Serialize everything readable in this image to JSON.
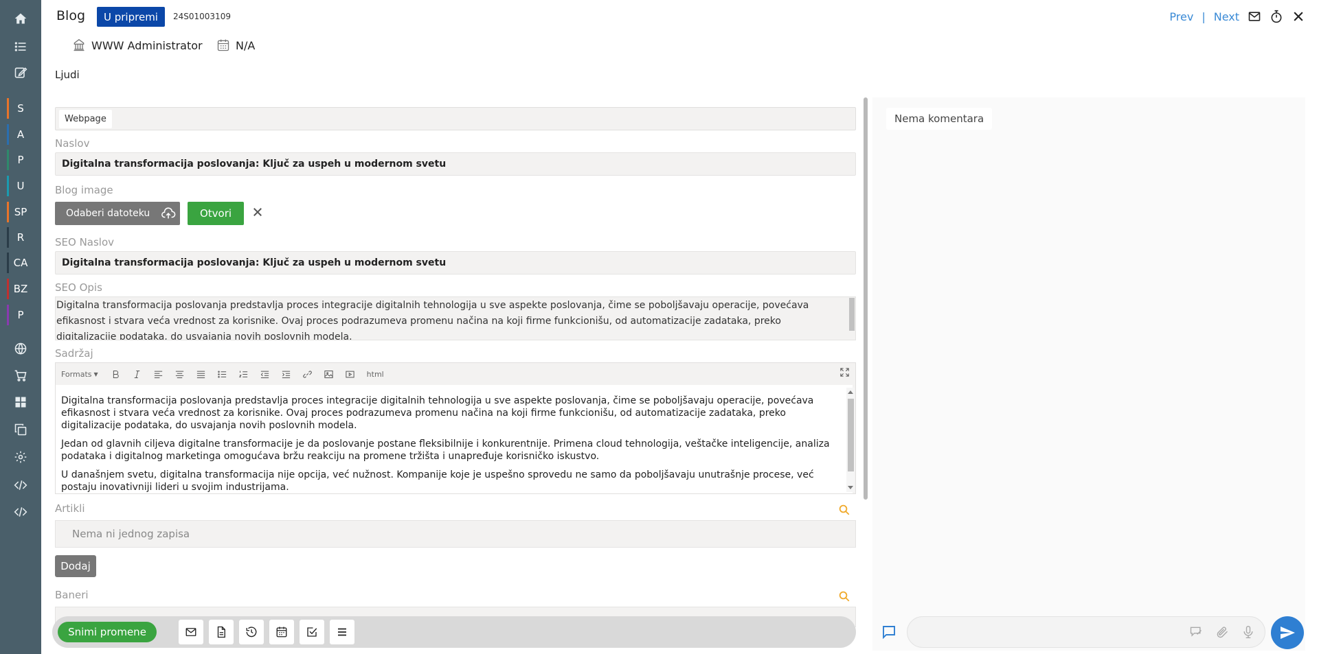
{
  "header": {
    "title": "Blog",
    "status": "U pripremi",
    "doc_number": "24S01003109",
    "owner": "WWW Administrator",
    "date": "N/A",
    "prev": "Prev",
    "next": "Next",
    "separator": "|"
  },
  "sidebar": {
    "icons": [
      "home-icon",
      "list-icon",
      "edit-icon"
    ],
    "letters": [
      {
        "label": "S",
        "color": "#e8742a"
      },
      {
        "label": "A",
        "color": "#2a6fb0"
      },
      {
        "label": "P",
        "color": "#2f8a6c"
      },
      {
        "label": "U",
        "color": "#1a9bb0"
      },
      {
        "label": "SP",
        "color": "#e8742a"
      },
      {
        "label": "R",
        "color": "#2a3c48"
      },
      {
        "label": "CA",
        "color": "#2a3c48"
      },
      {
        "label": "BZ",
        "color": "#c03030"
      },
      {
        "label": "P",
        "color": "#8a3ab0"
      }
    ],
    "bottom_icons": [
      "globe-icon",
      "cart-icon",
      "dashboard-icon",
      "copy-icon",
      "settings-icon",
      "code-icon",
      "code-icon"
    ]
  },
  "section": "Ljudi",
  "form": {
    "tab": "Webpage",
    "title_label": "Naslov",
    "title_value": "Digitalna transformacija poslovanja: Ključ za uspeh u modernom svetu",
    "image_label": "Blog image",
    "choose_file": "Odaberi datoteku",
    "open": "Otvori",
    "seo_title_label": "SEO Naslov",
    "seo_title_value": "Digitalna transformacija poslovanja: Ključ za uspeh u modernom svetu",
    "seo_desc_label": "SEO Opis",
    "seo_desc_value": "Digitalna transformacija poslovanja predstavlja proces integracije digitalnih tehnologija u sve aspekte poslovanja, čime se poboljšavaju operacije, povećava efikasnost i stvara veća vrednost za korisnike. Ovaj proces podrazumeva promenu načina na koji firme funkcionišu, od automatizacije zadataka, preko digitalizacije podataka, do usvajanja novih poslovnih modela.",
    "content_label": "Sadržaj",
    "toolbar_formats": "Formats",
    "toolbar_html": "html",
    "content_paragraphs": [
      "Digitalna transformacija poslovanja predstavlja proces integracije digitalnih tehnologija u sve aspekte poslovanja, čime se poboljšavaju operacije, povećava efikasnost i stvara veća vrednost za korisnike. Ovaj proces podrazumeva promenu načina na koji firme funkcionišu, od automatizacije zadataka, preko digitalizacije podataka, do usvajanja novih poslovnih modela.",
      "Jedan od glavnih ciljeva digitalne transformacije je da poslovanje postane fleksibilnije i konkurentnije. Primena cloud tehnologija, veštačke inteligencije, analiza podataka i digitalnog marketinga omogućava bržu reakciju na promene tržišta i unapređuje korisničko iskustvo.",
      "U današnjem svetu, digitalna transformacija nije opcija, već nužnost. Kompanije koje je uspešno sprovedu ne samo da poboljšavaju unutrašnje procese, već postaju inovativniji lideri u svojim industrijama."
    ],
    "articles_label": "Artikli",
    "articles_empty": "Nema ni jednog zapisa",
    "add_button": "Dodaj",
    "banners_label": "Baneri"
  },
  "actions": {
    "save": "Snimi promene"
  },
  "comments": {
    "empty": "Nema komentara"
  }
}
